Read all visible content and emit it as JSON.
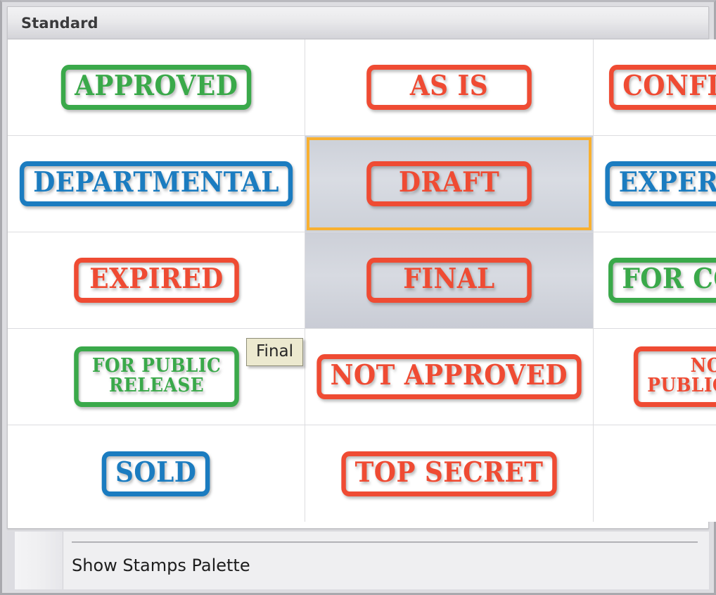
{
  "window": {
    "accent_selected": "#f8b030",
    "stamp_red": "#ef4b33",
    "stamp_green": "#3aa94a",
    "stamp_blue": "#1b7cc0"
  },
  "palette": {
    "title": "Standard",
    "columns": 3,
    "stamps": [
      {
        "label": "APPROVED",
        "lines": [
          "APPROVED"
        ],
        "color": "green",
        "state": "normal"
      },
      {
        "label": "AS IS",
        "lines": [
          "AS IS"
        ],
        "color": "red",
        "state": "normal"
      },
      {
        "label": "CONFIDENTIAL",
        "lines": [
          "CONFIDENTIAL"
        ],
        "color": "red",
        "state": "normal"
      },
      {
        "label": "DEPARTMENTAL",
        "lines": [
          "DEPARTMENTAL"
        ],
        "color": "blue",
        "state": "normal"
      },
      {
        "label": "DRAFT",
        "lines": [
          "DRAFT"
        ],
        "color": "red",
        "state": "selected"
      },
      {
        "label": "EXPERIMENTAL",
        "lines": [
          "EXPERIMENTAL"
        ],
        "color": "blue",
        "state": "normal"
      },
      {
        "label": "EXPIRED",
        "lines": [
          "EXPIRED"
        ],
        "color": "red",
        "state": "normal"
      },
      {
        "label": "FINAL",
        "lines": [
          "FINAL"
        ],
        "color": "red",
        "state": "hover"
      },
      {
        "label": "FOR COMMENT",
        "lines": [
          "FOR COMMENT"
        ],
        "color": "green",
        "state": "normal"
      },
      {
        "label": "FOR PUBLIC RELEASE",
        "lines": [
          "FOR PUBLIC",
          "RELEASE"
        ],
        "color": "green",
        "state": "normal"
      },
      {
        "label": "NOT APPROVED",
        "lines": [
          "NOT APPROVED"
        ],
        "color": "red",
        "state": "normal"
      },
      {
        "label": "NOT FOR PUBLIC RELEASE",
        "lines": [
          "NOT FOR",
          "PUBLIC RELEASE"
        ],
        "color": "red",
        "state": "normal"
      },
      {
        "label": "SOLD",
        "lines": [
          "SOLD"
        ],
        "color": "blue",
        "state": "normal"
      },
      {
        "label": "TOP SECRET",
        "lines": [
          "TOP SECRET"
        ],
        "color": "red",
        "state": "normal"
      },
      {
        "label": "",
        "lines": [],
        "color": "none",
        "state": "empty"
      }
    ]
  },
  "tooltip": {
    "text": "Final",
    "visible": true
  },
  "menu": {
    "items": [
      {
        "label": "Show Stamps Palette"
      }
    ]
  }
}
